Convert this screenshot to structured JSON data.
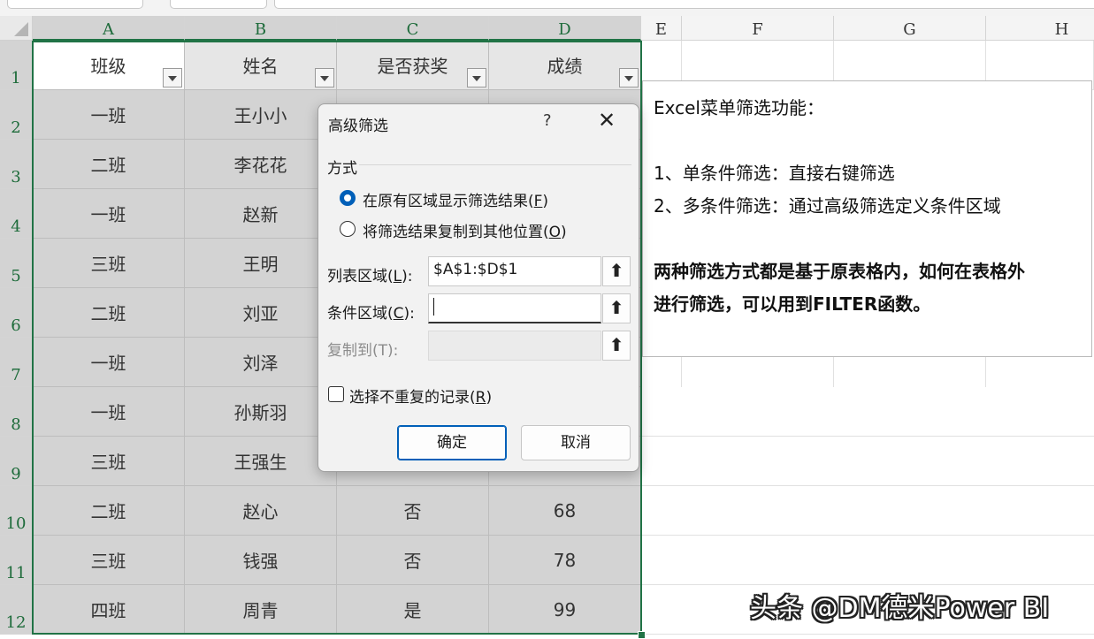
{
  "sheet": {
    "columns": [
      "A",
      "B",
      "C",
      "D",
      "E",
      "F",
      "G",
      "H"
    ],
    "rows": [
      "1",
      "2",
      "3",
      "4",
      "5",
      "6",
      "7",
      "8",
      "9",
      "10",
      "11",
      "12"
    ],
    "table": {
      "headers": [
        "班级",
        "姓名",
        "是否获奖",
        "成绩"
      ],
      "cells": [
        [
          "一班",
          "王小小",
          "",
          ""
        ],
        [
          "二班",
          "李花花",
          "",
          ""
        ],
        [
          "一班",
          "赵新",
          "",
          ""
        ],
        [
          "三班",
          "王明",
          "",
          ""
        ],
        [
          "二班",
          "刘亚",
          "",
          ""
        ],
        [
          "一班",
          "刘泽",
          "",
          ""
        ],
        [
          "一班",
          "孙斯羽",
          "",
          ""
        ],
        [
          "三班",
          "王强生",
          "",
          ""
        ],
        [
          "二班",
          "赵心",
          "否",
          "68"
        ],
        [
          "三班",
          "钱强",
          "否",
          "78"
        ],
        [
          "四班",
          "周青",
          "是",
          "99"
        ]
      ]
    }
  },
  "textbox": {
    "line1": "Excel菜单筛选功能：",
    "line2": "1、单条件筛选：直接右键筛选",
    "line3": "2、多条件筛选：通过高级筛选定义条件区域",
    "bold1": "两种筛选方式都是基于原表格内，如何在表格外",
    "bold2": "进行筛选，可以用到FILTER函数。"
  },
  "watermark": "头条 @DM德米Power BI",
  "dialog": {
    "title": "高级筛选",
    "help": "?",
    "close": "✕",
    "method_label": "方式",
    "radio1": {
      "text": "在原有区域显示筛选结果(",
      "key": "F",
      "end": ")",
      "selected": true
    },
    "radio2": {
      "text": "将筛选结果复制到其他位置(",
      "key": "O",
      "end": ")",
      "selected": false
    },
    "list_range": {
      "label": "列表区域(",
      "key": "L",
      "end": "):",
      "value": "$A$1:$D$1"
    },
    "criteria_range": {
      "label": "条件区域(",
      "key": "C",
      "end": "):",
      "value": ""
    },
    "copy_to": {
      "label": "复制到(T):",
      "value": ""
    },
    "ref_icon": "⬆",
    "unique": {
      "text": "选择不重复的记录(",
      "key": "R",
      "end": ")",
      "checked": false
    },
    "ok": "确定",
    "cancel": "取消"
  }
}
